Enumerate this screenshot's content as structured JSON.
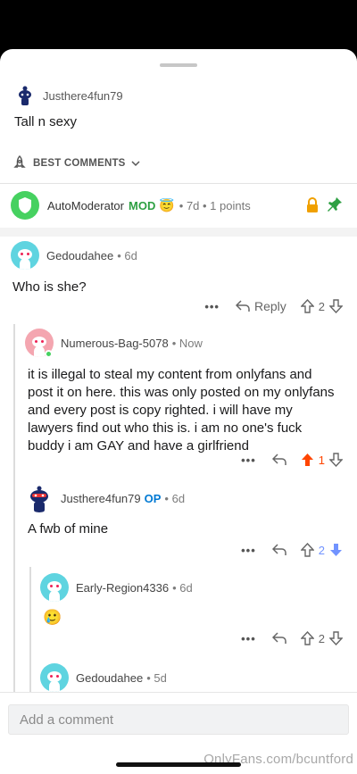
{
  "post": {
    "author": "Justhere4fun79",
    "title": "Tall n sexy"
  },
  "sort": {
    "label": "BEST COMMENTS"
  },
  "automod": {
    "name": "AutoModerator",
    "mod_badge": "MOD",
    "emoji": "😇",
    "meta": "• 7d • 1 points"
  },
  "comments": [
    {
      "author": "Gedoudahee",
      "meta": "• 6d",
      "text": "Who is she?",
      "reply_label": "Reply",
      "score": "2"
    },
    {
      "author": "Numerous-Bag-5078",
      "meta": "• Now",
      "text": "it is illegal to steal my content from onlyfans and post it on here. this was only posted on my onlyfans and every post is copy righted. i will have my lawyers find out who this is. i am no one's fuck buddy i am GAY and have  a girlfriend",
      "score": "1"
    },
    {
      "author": "Justhere4fun79",
      "op": "OP",
      "meta": "• 6d",
      "text": "A fwb of mine",
      "score": "2"
    },
    {
      "author": "Early-Region4336",
      "meta": "• 6d",
      "text": "🥲",
      "score": "2"
    },
    {
      "author": "Gedoudahee",
      "meta": "• 5d"
    }
  ],
  "composer": {
    "placeholder": "Add a comment"
  },
  "watermark": "OnlyFans.com/bcuntford",
  "colors": {
    "upvote": "#ff4500",
    "downvote": "#7193ff",
    "mod": "#2ea043",
    "op": "#0079d3"
  }
}
